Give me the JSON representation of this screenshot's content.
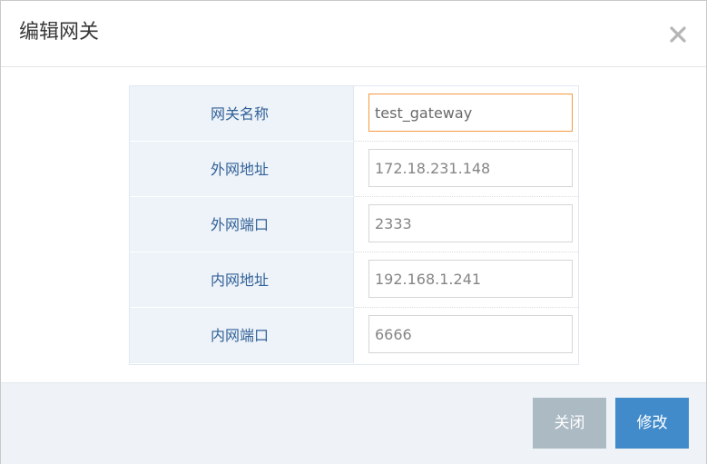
{
  "dialog": {
    "title": "编辑网关"
  },
  "form": {
    "rows": [
      {
        "label": "网关名称",
        "value": "test_gateway"
      },
      {
        "label": "外网地址",
        "value": "172.18.231.148"
      },
      {
        "label": "外网端口",
        "value": "2333"
      },
      {
        "label": "内网地址",
        "value": "192.168.1.241"
      },
      {
        "label": "内网端口",
        "value": "6666"
      }
    ]
  },
  "footer": {
    "close_label": "关闭",
    "submit_label": "修改"
  },
  "icons": {
    "close": "close-icon"
  },
  "colors": {
    "label_text": "#336199",
    "label_bg": "#edf3f8",
    "focus_border": "#f59942",
    "close_button": "#abbac3",
    "submit_button": "#428bca"
  }
}
